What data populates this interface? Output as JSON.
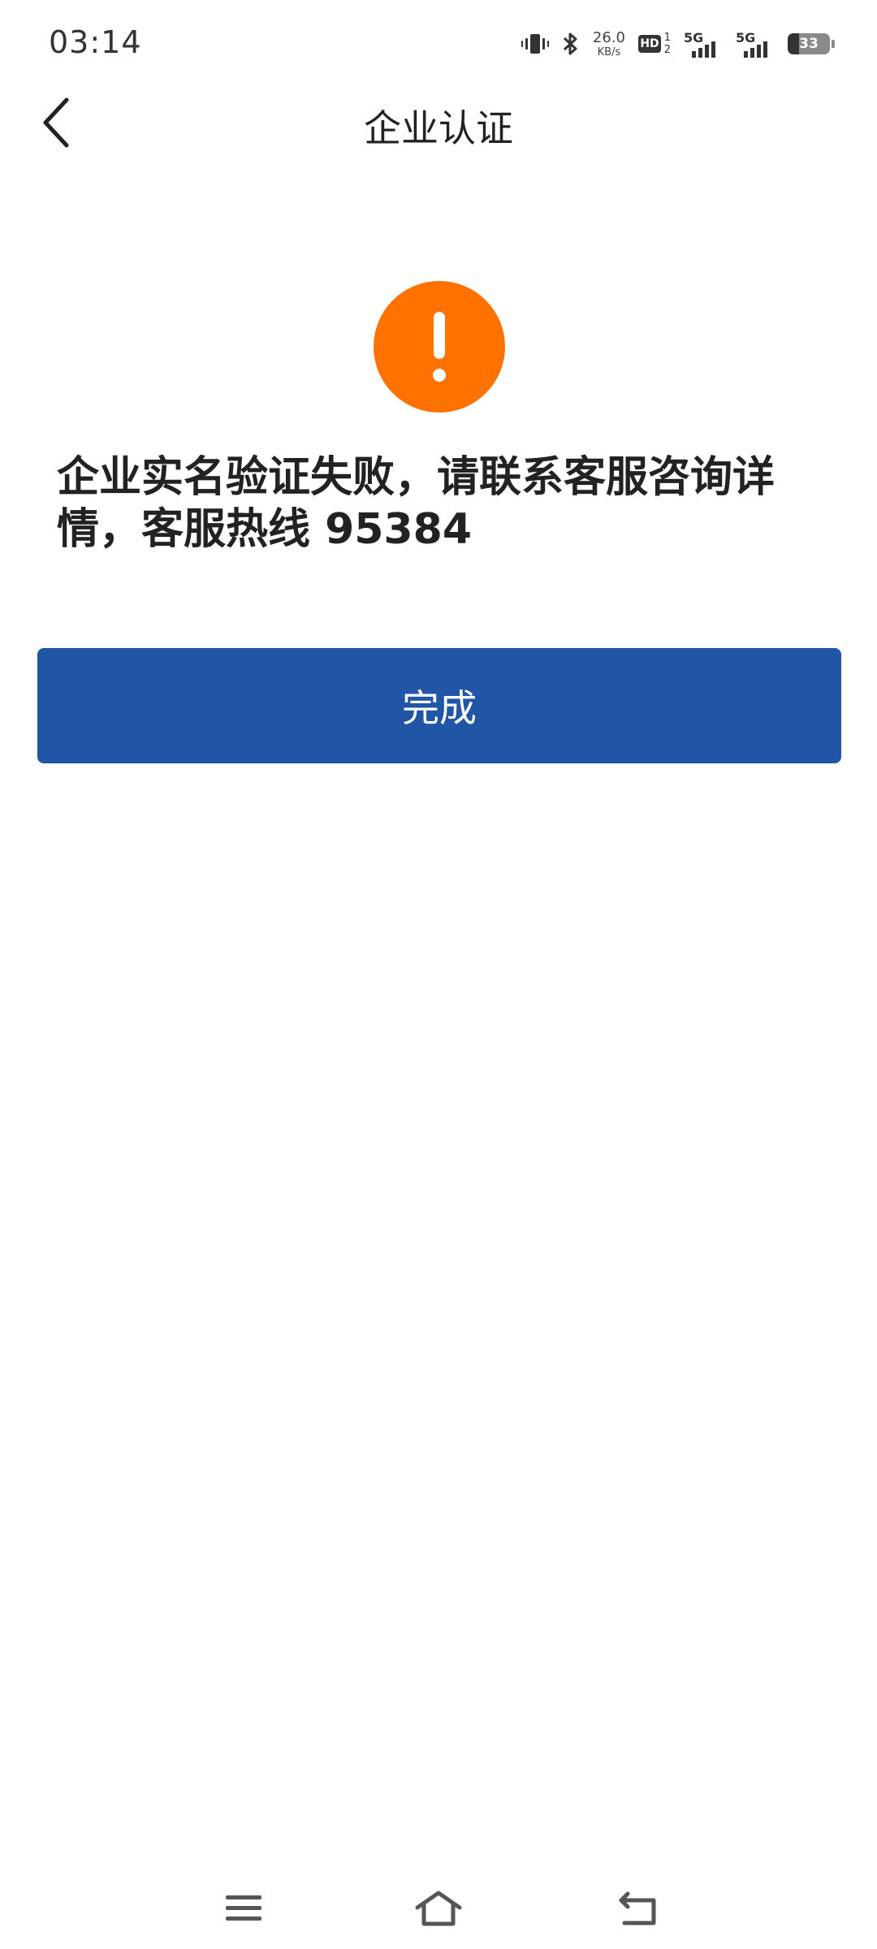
{
  "status_bar": {
    "time": "03:14",
    "net_speed_value": "26.0",
    "net_speed_unit": "KB/s",
    "hd_label": "HD",
    "sim_index_top": "1",
    "sim_index_bottom": "2",
    "network_1": "5G",
    "network_2": "5G",
    "battery_level": "33",
    "icons": [
      "vibrate-icon",
      "bluetooth-icon",
      "hd-volte-icon",
      "signal-5g-icon",
      "signal-5g-icon",
      "battery-icon"
    ]
  },
  "header": {
    "title": "企业认证",
    "back_icon": "chevron-left-icon"
  },
  "result": {
    "icon": "warning-icon",
    "icon_color": "#ff7200",
    "message": "企业实名验证失败，请联系客服咨询详情，客服热线 95384"
  },
  "actions": {
    "done_label": "完成",
    "done_color": "#2155a6"
  },
  "system_nav": {
    "items": [
      "menu-icon",
      "home-icon",
      "back-icon"
    ]
  }
}
